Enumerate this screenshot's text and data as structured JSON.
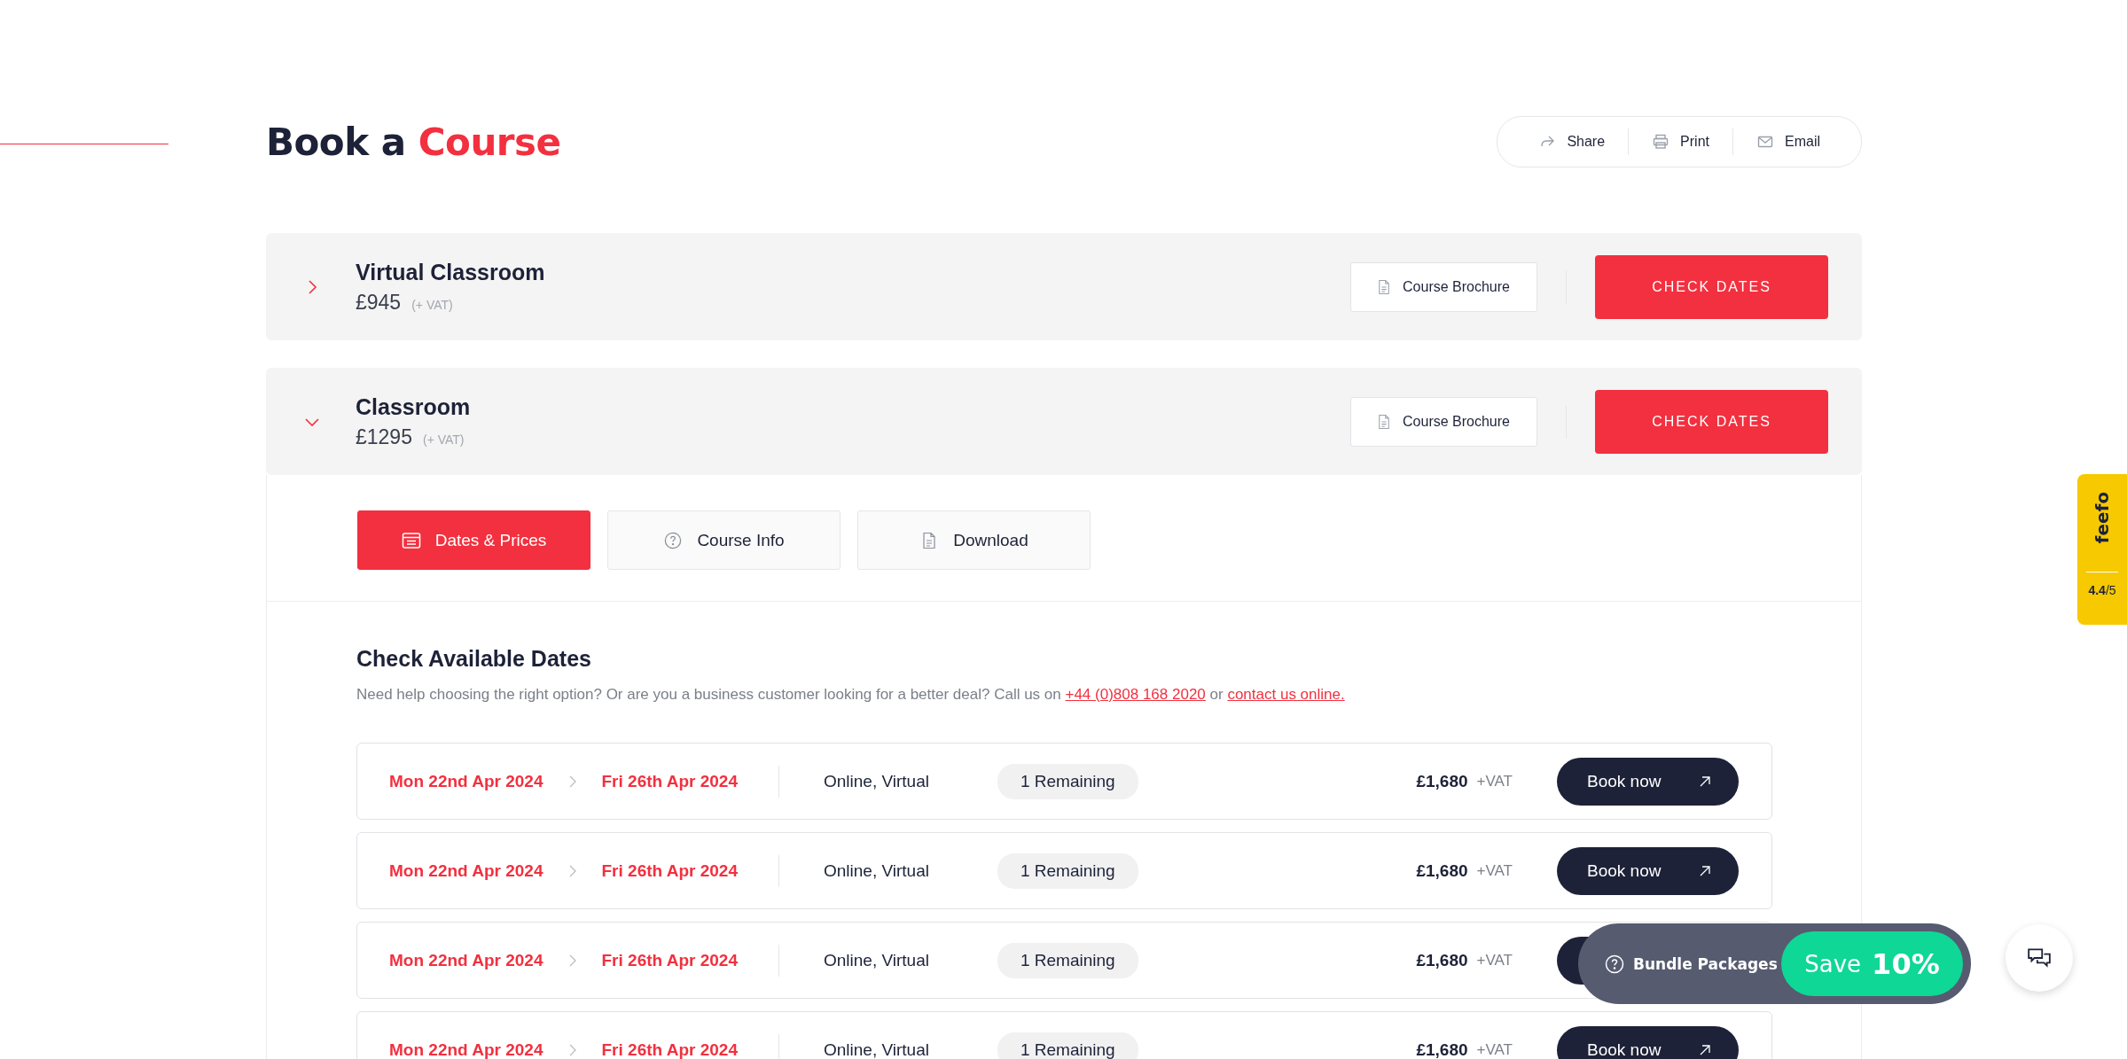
{
  "page": {
    "title": "Book a",
    "title_highlight": "Course"
  },
  "share_actions": [
    {
      "label": "Share",
      "kind": "share"
    },
    {
      "label": "Print",
      "kind": "print"
    },
    {
      "label": "Email",
      "kind": "email"
    }
  ],
  "courses": [
    {
      "name": "Virtual Classroom",
      "price": "£945",
      "vat": "(+ VAT)",
      "expanded": false,
      "brochure": "Course Brochure",
      "action": "CHECK DATES"
    },
    {
      "name": "Classroom",
      "price": "£1295",
      "vat": "(+ VAT)",
      "expanded": true,
      "brochure": "Course Brochure",
      "action": "CHECK DATES"
    }
  ],
  "tabs": [
    {
      "label": "Dates & Prices",
      "kind": "dates",
      "selected": true
    },
    {
      "label": "Course Info",
      "kind": "info",
      "selected": false
    },
    {
      "label": "Download",
      "kind": "download",
      "selected": false
    }
  ],
  "dates_section": {
    "heading": "Check Available Dates",
    "text_before": "Need help choosing the right option? Or are you a business customer looking for a better deal? Call us on",
    "phone": "+44 (0)808 168 2020",
    "text_middle": "or",
    "link": "contact us online."
  },
  "date_rows": [
    {
      "start": "Mon 22nd Apr 2024",
      "end": "Fri 26th Apr 2024",
      "location": "Online, Virtual",
      "remaining": "1 Remaining",
      "price": "£1,680",
      "vat": "+VAT",
      "book": "Book now"
    },
    {
      "start": "Mon 22nd Apr 2024",
      "end": "Fri 26th Apr 2024",
      "location": "Online, Virtual",
      "remaining": "1 Remaining",
      "price": "£1,680",
      "vat": "+VAT",
      "book": "Book now"
    },
    {
      "start": "Mon 22nd Apr 2024",
      "end": "Fri 26th Apr 2024",
      "location": "Online, Virtual",
      "remaining": "1 Remaining",
      "price": "£1,680",
      "vat": "+VAT"
    },
    {
      "start": "Mon 22nd Apr 2024",
      "end": "Fri 26th Apr 2024",
      "location": "Online, Virtual",
      "remaining": "1 Remaining",
      "price": "£1,680",
      "vat": "+VAT",
      "book": "Book now"
    }
  ],
  "bundle": {
    "label": "Bundle Packages",
    "save": "Save",
    "percent": "10%"
  },
  "feefo": {
    "logo": "feefo",
    "rating": "**4.4**/5"
  }
}
